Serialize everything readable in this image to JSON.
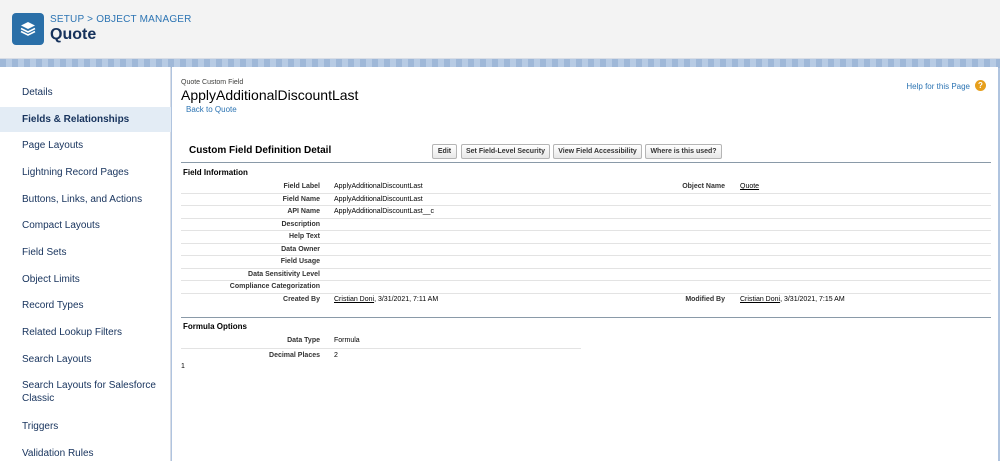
{
  "header": {
    "breadcrumb_setup": "SETUP",
    "breadcrumb_sep": ">",
    "breadcrumb_object_manager": "OBJECT MANAGER",
    "title": "Quote"
  },
  "sidebar": {
    "items": [
      {
        "label": "Details"
      },
      {
        "label": "Fields & Relationships"
      },
      {
        "label": "Page Layouts"
      },
      {
        "label": "Lightning Record Pages"
      },
      {
        "label": "Buttons, Links, and Actions"
      },
      {
        "label": "Compact Layouts"
      },
      {
        "label": "Field Sets"
      },
      {
        "label": "Object Limits"
      },
      {
        "label": "Record Types"
      },
      {
        "label": "Related Lookup Filters"
      },
      {
        "label": "Search Layouts"
      },
      {
        "label": "Search Layouts for Salesforce Classic"
      },
      {
        "label": "Triggers"
      },
      {
        "label": "Validation Rules"
      }
    ],
    "active": "Fields & Relationships"
  },
  "main": {
    "object_type": "Quote Custom Field",
    "field_title": "ApplyAdditionalDiscountLast",
    "back_link": "Back to Quote",
    "help_link": "Help for this Page",
    "help_icon": "?",
    "detail_title": "Custom Field Definition Detail",
    "buttons": {
      "edit": "Edit",
      "fls": "Set Field-Level Security",
      "accessibility": "View Field Accessibility",
      "where_used": "Where is this used?"
    },
    "field_info": {
      "section_title": "Field Information",
      "field_label_lbl": "Field Label",
      "field_label_val": "ApplyAdditionalDiscountLast",
      "object_name_lbl": "Object Name",
      "object_name_val": "Quote",
      "field_name_lbl": "Field Name",
      "field_name_val": "ApplyAdditionalDiscountLast",
      "api_name_lbl": "API Name",
      "api_name_val": "ApplyAdditionalDiscountLast__c",
      "description_lbl": "Description",
      "help_text_lbl": "Help Text",
      "data_owner_lbl": "Data Owner",
      "field_usage_lbl": "Field Usage",
      "sensitivity_lbl": "Data Sensitivity Level",
      "compliance_lbl": "Compliance Categorization",
      "created_by_lbl": "Created By",
      "created_by_user": "Cristian Doni",
      "created_by_date": ", 3/31/2021, 7:11 AM",
      "modified_by_lbl": "Modified By",
      "modified_by_user": "Cristian Doni",
      "modified_by_date": ", 3/31/2021, 7:15 AM"
    },
    "formula": {
      "section_title": "Formula Options",
      "data_type_lbl": "Data Type",
      "data_type_val": "Formula",
      "decimal_lbl": "Decimal Places",
      "decimal_val": "2",
      "stray_value": "1"
    }
  },
  "colors": {
    "accent": "#2c74b3",
    "header_icon": "#2a6fa8",
    "help_icon": "#e69f1c",
    "active_sidebar": "#e3ecf5"
  }
}
